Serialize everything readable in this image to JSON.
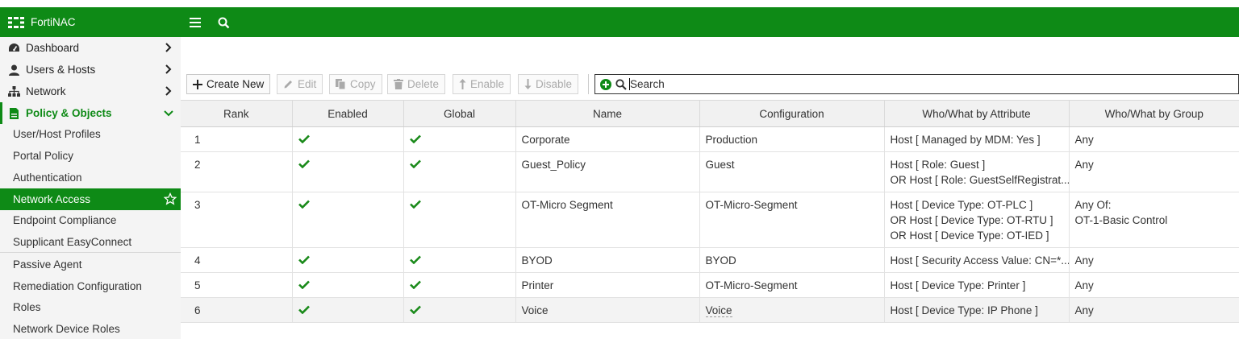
{
  "app": {
    "title": "FortiNAC"
  },
  "sidebar": {
    "items": [
      {
        "label": "Dashboard",
        "icon": "dashboard-icon"
      },
      {
        "label": "Users & Hosts",
        "icon": "user-icon"
      },
      {
        "label": "Network",
        "icon": "network-icon"
      },
      {
        "label": "Policy & Objects",
        "icon": "policy-icon"
      }
    ],
    "subitems": [
      "User/Host Profiles",
      "Portal Policy",
      "Authentication",
      "Network Access",
      "Endpoint Compliance",
      "Supplicant EasyConnect",
      "Passive Agent",
      "Remediation Configuration",
      "Roles",
      "Network Device Roles"
    ],
    "active": "Network Access"
  },
  "toolbar": {
    "create_new": "Create New",
    "edit": "Edit",
    "copy": "Copy",
    "delete": "Delete",
    "enable": "Enable",
    "disable": "Disable",
    "search_placeholder": "Search"
  },
  "table": {
    "columns": [
      "Rank",
      "Enabled",
      "Global",
      "Name",
      "Configuration",
      "Who/What by Attribute",
      "Who/What by Group"
    ],
    "rows": [
      {
        "rank": "1",
        "enabled": true,
        "global": true,
        "name": "Corporate",
        "configuration": "Production",
        "attribute": [
          "Host [ Managed by MDM: Yes ]"
        ],
        "group": [
          "Any"
        ]
      },
      {
        "rank": "2",
        "enabled": true,
        "global": true,
        "name": "Guest_Policy",
        "configuration": "Guest",
        "attribute": [
          "Host [ Role: Guest ]",
          "OR Host [ Role: GuestSelfRegistrat..."
        ],
        "group": [
          "Any"
        ]
      },
      {
        "rank": "3",
        "enabled": true,
        "global": true,
        "name": "OT-Micro Segment",
        "configuration": "OT-Micro-Segment",
        "attribute": [
          "Host [ Device Type: OT-PLC ]",
          "OR Host [ Device Type: OT-RTU ]",
          "OR Host [ Device Type: OT-IED ]"
        ],
        "group": [
          "Any Of:",
          "OT-1-Basic Control"
        ]
      },
      {
        "rank": "4",
        "enabled": true,
        "global": true,
        "name": "BYOD",
        "configuration": "BYOD",
        "attribute": [
          "Host [ Security Access Value: CN=*..."
        ],
        "group": [
          "Any"
        ]
      },
      {
        "rank": "5",
        "enabled": true,
        "global": true,
        "name": "Printer",
        "configuration": "OT-Micro-Segment",
        "attribute": [
          "Host [ Device Type: Printer ]"
        ],
        "group": [
          "Any"
        ]
      },
      {
        "rank": "6",
        "enabled": true,
        "global": true,
        "name": "Voice",
        "configuration": "Voice",
        "attribute": [
          "Host [ Device Type: IP Phone ]"
        ],
        "group": [
          "Any"
        ]
      }
    ]
  },
  "colors": {
    "brand_green": "#0e8a16",
    "check_green": "#1a8a1a"
  }
}
